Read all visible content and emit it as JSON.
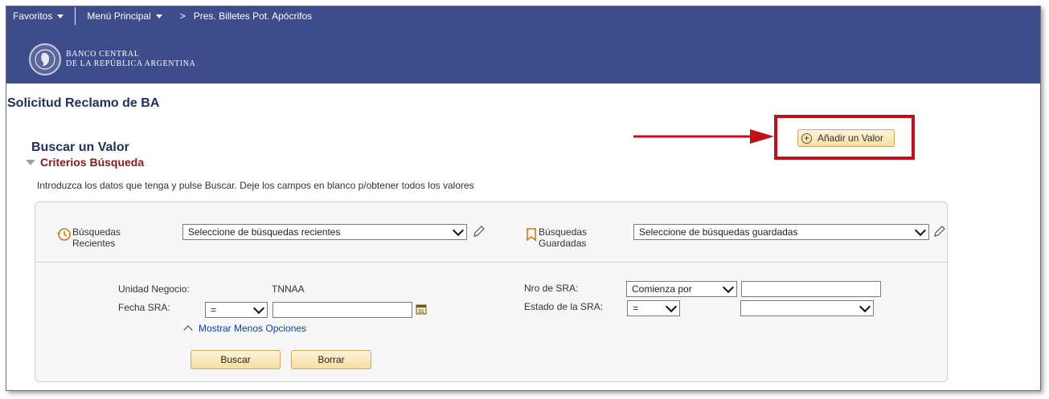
{
  "nav": {
    "favorites": "Favoritos",
    "main_menu": "Menú Principal",
    "separator": ">",
    "breadcrumb_current": "Pres. Billetes Pot. Apócrifos"
  },
  "logo": {
    "line1": "BANCO CENTRAL",
    "line2": "DE LA REPÚBLICA ARGENTINA"
  },
  "page": {
    "title": "Solicitud Reclamo de BA"
  },
  "search": {
    "section_title": "Buscar un Valor",
    "criteria_label": "Criterios Búsqueda",
    "instructions": "Introduzca los datos que tenga y pulse Buscar. Deje los campos en blanco p/obtener todos los valores",
    "add_value_label": "Añadir un Valor"
  },
  "recent": {
    "label_line1": "Búsquedas",
    "label_line2": "Recientes",
    "select_value": "Seleccione de búsquedas recientes"
  },
  "saved": {
    "label_line1": "Búsquedas",
    "label_line2": "Guardadas",
    "select_value": "Seleccione de búsquedas guardadas"
  },
  "fields": {
    "business_unit_label": "Unidad Negocio:",
    "business_unit_value": "TNNAA",
    "sra_date_label": "Fecha SRA:",
    "sra_date_operator": "=",
    "sra_date_value": "",
    "sra_number_label": "Nro de SRA:",
    "sra_number_operator": "Comienza por",
    "sra_number_value": "",
    "sra_status_label": "Estado de la SRA:",
    "sra_status_operator": "=",
    "sra_status_value": ""
  },
  "options_link": "Mostrar Menos Opciones",
  "buttons": {
    "search": "Buscar",
    "clear": "Borrar"
  },
  "colors": {
    "header_bg": "#3d4c8a",
    "title_blue": "#1f2f5e",
    "criteria_red": "#8b1a1a",
    "highlight_red": "#c0101a",
    "button_bg": "#f6dea0",
    "link_blue": "#0b3fb3"
  }
}
